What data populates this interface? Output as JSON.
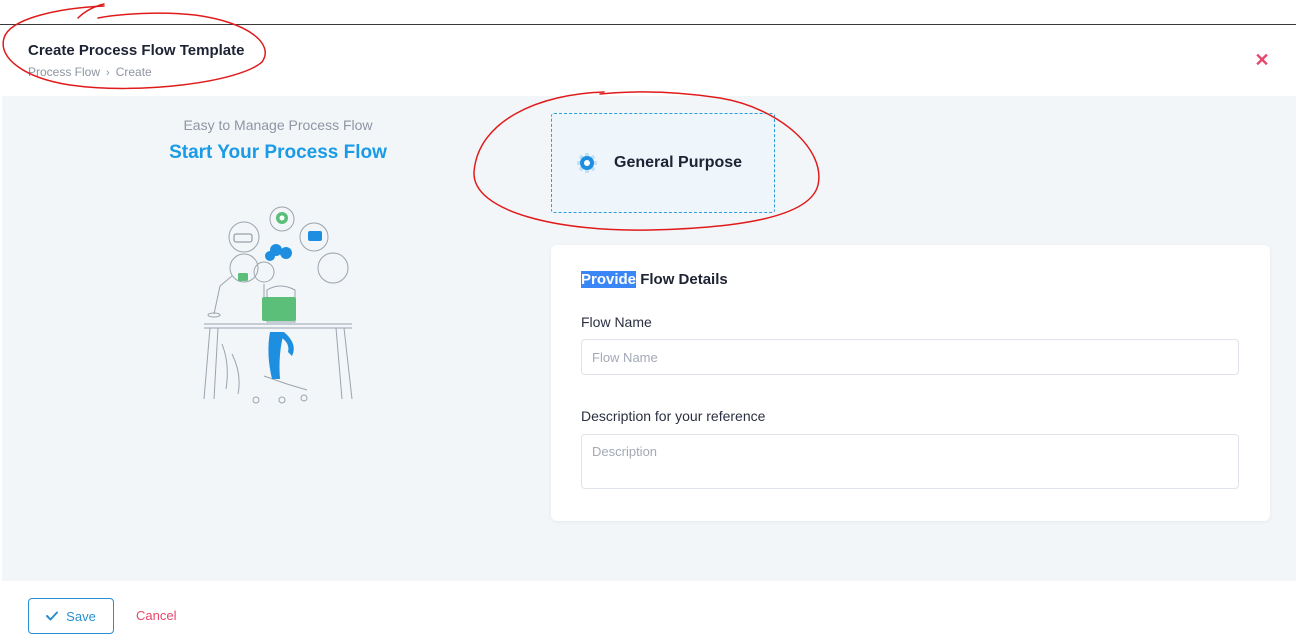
{
  "header": {
    "title": "Create Process Flow Template",
    "breadcrumb": {
      "parent": "Process Flow",
      "separator": "›",
      "current": "Create"
    },
    "close_icon": "close-icon"
  },
  "intro": {
    "subtitle": "Easy to Manage Process Flow",
    "heading": "Start Your Process Flow"
  },
  "flow_type": {
    "label": "General Purpose",
    "icon": "gear-icon"
  },
  "details": {
    "title_highlight": "Provide",
    "title_rest": " Flow Details",
    "flow_name": {
      "label": "Flow Name",
      "placeholder": "Flow Name",
      "value": ""
    },
    "description": {
      "label": "Description for your reference",
      "placeholder": "Description",
      "value": ""
    }
  },
  "footer": {
    "save_label": "Save",
    "save_icon": "check-icon",
    "cancel_label": "Cancel"
  },
  "colors": {
    "accent": "#1a9be6",
    "danger": "#e8466a",
    "annotation": "#e01b1b",
    "highlight": "#3b86f7"
  }
}
